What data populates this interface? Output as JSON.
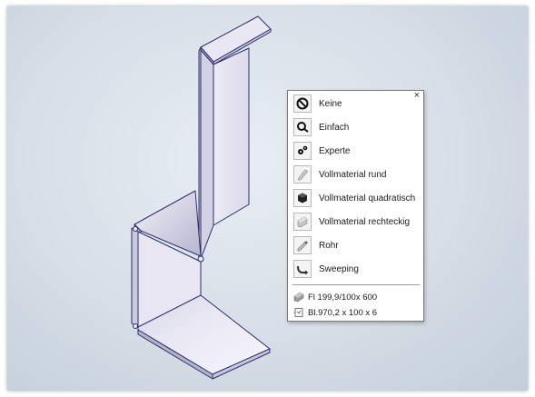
{
  "menu": {
    "close_label": "×",
    "items": [
      {
        "label": "Keine",
        "icon": "no-entry-icon"
      },
      {
        "label": "Einfach",
        "icon": "simple-magnifier-icon"
      },
      {
        "label": "Experte",
        "icon": "gears-icon"
      },
      {
        "label": "Vollmaterial rund",
        "icon": "round-bar-icon"
      },
      {
        "label": "Vollmaterial quadratisch",
        "icon": "square-bar-icon"
      },
      {
        "label": "Vollmaterial rechteckig",
        "icon": "rectangular-bar-icon"
      },
      {
        "label": "Rohr",
        "icon": "tube-icon"
      },
      {
        "label": "Sweeping",
        "icon": "sweep-icon"
      }
    ],
    "info": [
      {
        "text": "Fl 199,9/100x 600",
        "icon": "flat-bar-icon"
      },
      {
        "text": "Bl.970,2 x 100 x 6",
        "icon": "sheet-icon"
      }
    ]
  },
  "colors": {
    "viewport_bg": "#d9e1ea",
    "part_face": "#e7e5f2",
    "part_edge": "#2d2f6a"
  }
}
